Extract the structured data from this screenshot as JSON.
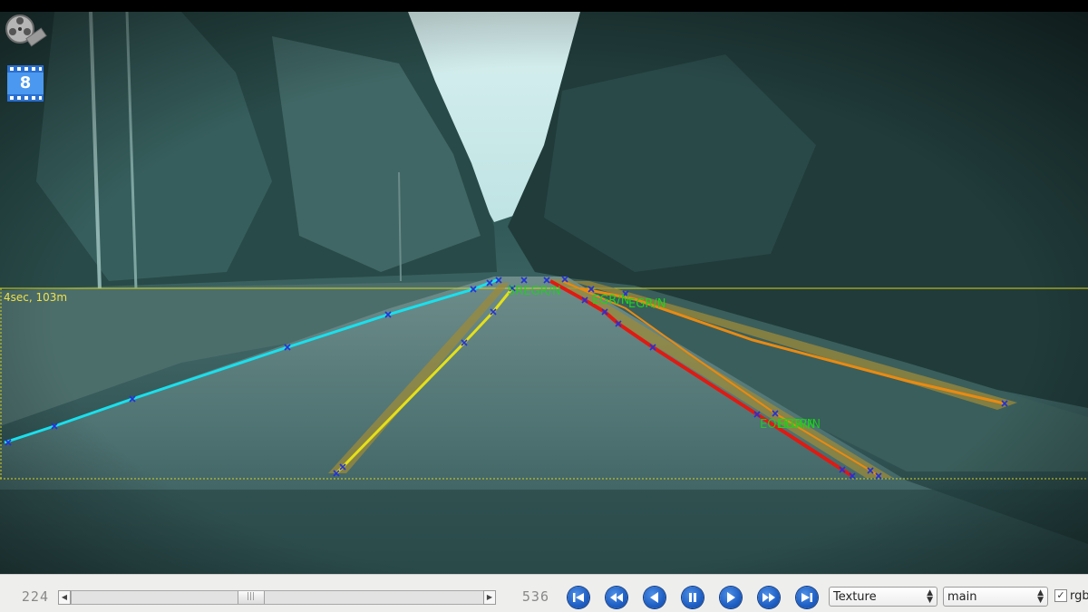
{
  "viewport": {
    "time_distance_label": "4sec, 103m",
    "lane_labels": [
      "EGR/N",
      "EGR/N",
      "EGR/N",
      "EOLEGR/N",
      "SREGR/N"
    ]
  },
  "app_icons": {
    "badge_number": "8",
    "reel_icon": "film-reel-icon",
    "clapper_icon": "clapperboard-icon"
  },
  "toolbar": {
    "start_frame": "224",
    "end_frame": "536",
    "scroll_position": 0.43,
    "scroll_left_icon": "arrow-left-icon",
    "scroll_right_icon": "arrow-right-icon",
    "nav_buttons": [
      {
        "name": "skip-to-start",
        "icon": "skip-start-icon"
      },
      {
        "name": "fast-rewind",
        "icon": "fast-rewind-icon"
      },
      {
        "name": "step-back",
        "icon": "step-back-icon"
      },
      {
        "name": "pause",
        "icon": "pause-icon"
      },
      {
        "name": "play",
        "icon": "play-icon"
      },
      {
        "name": "fast-forward",
        "icon": "fast-forward-icon"
      },
      {
        "name": "skip-to-end",
        "icon": "skip-end-icon"
      }
    ],
    "render_mode_select": "Texture",
    "layer_select": "main",
    "rgb_checked": true,
    "rgb_label": "rgb"
  },
  "colors": {
    "lane_cyan": "#19e0ee",
    "lane_yellow": "#e5e018",
    "lane_red": "#e01a12",
    "lane_orange": "#e98a12",
    "lane_shade": "#9c8a3a",
    "marker_blue": "#2232d8",
    "horizon_line": "#d9d418",
    "label_green": "#1fd11f",
    "nav_blue": "#1f5fc4"
  }
}
